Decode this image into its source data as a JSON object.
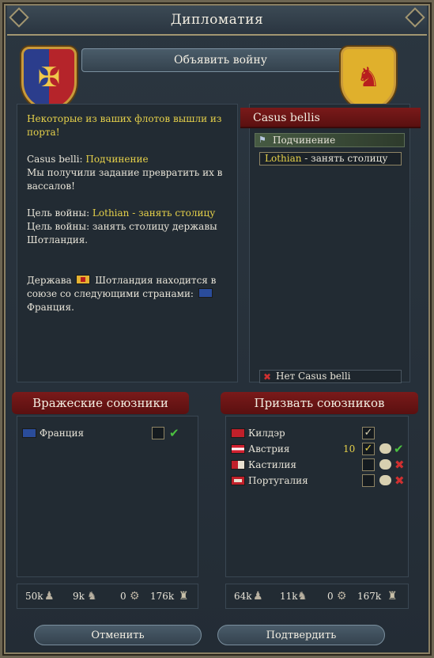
{
  "window": {
    "title": "Дипломатия"
  },
  "declare": {
    "label": "Объявить войну"
  },
  "info": {
    "fleet_warning": "Некоторые из ваших флотов вышли из порта!",
    "cb_prefix": "Casus belli: ",
    "cb_value": "Подчинение",
    "cb_desc": "Мы получили задание превратить их в вассалов!",
    "goal_prefix": "Цель войны: ",
    "goal_value": "Lothian - занять столицу",
    "goal_desc": "Цель войны: занять столицу державы Шотландия.",
    "alliance_prefix": "Держава ",
    "alliance_mid": "Шотландия находится в союзе со следующими странами: ",
    "alliance_ally": "Франция."
  },
  "casus_belli": {
    "header": "Casus bellis",
    "type": "Подчинение",
    "goal_highlight": "Lothian",
    "goal_rest": " - занять столицу",
    "none": "Нет Casus belli"
  },
  "enemy_allies": {
    "header": "Вражеские союзники",
    "items": [
      {
        "name": "Франция"
      }
    ],
    "stats": {
      "infantry": "50k",
      "cavalry": "9k",
      "artillery": "0",
      "total": "176k"
    }
  },
  "call_allies": {
    "header": "Призвать союзников",
    "items": [
      {
        "name": "Килдэр",
        "number": ""
      },
      {
        "name": "Австрия",
        "number": "10"
      },
      {
        "name": "Кастилия",
        "number": ""
      },
      {
        "name": "Португалия",
        "number": ""
      }
    ],
    "stats": {
      "infantry": "64k",
      "cavalry": "11k",
      "artillery": "0",
      "total": "167k"
    }
  },
  "buttons": {
    "cancel": "Отменить",
    "confirm": "Подтвердить"
  },
  "icons": {
    "infantry": "infantry-icon",
    "cavalry": "cavalry-icon",
    "artillery": "artillery-icon",
    "army": "army-total-icon",
    "check": "check-icon",
    "cross": "cross-icon",
    "chat": "chat-bubble-icon"
  },
  "colors": {
    "highlight": "#e6d14a",
    "header_red": "#7a1a1a",
    "accept_green": "#4bc040",
    "refuse_red": "#d03030"
  }
}
